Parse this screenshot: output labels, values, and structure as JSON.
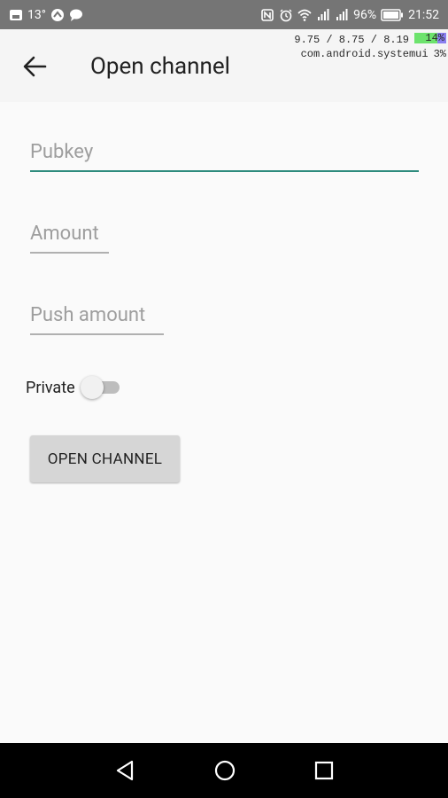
{
  "status_bar": {
    "temperature": "13°",
    "battery_percent": "96%",
    "time": "21:52"
  },
  "debug_overlay": {
    "load_text": "9.75 / 8.75 / 8.19",
    "load_value": "14%",
    "process_name": "com.android.systemui",
    "process_value": "3%"
  },
  "app_bar": {
    "title": "Open channel"
  },
  "form": {
    "pubkey_hint": "Pubkey",
    "amount_hint": "Amount",
    "push_amount_hint": "Push amount",
    "private_label": "Private",
    "private_enabled": false,
    "submit_label": "OPEN CHANNEL"
  },
  "colors": {
    "accent": "#2e8b7d",
    "status_bar": "#757575",
    "nav_bar": "#000000"
  }
}
